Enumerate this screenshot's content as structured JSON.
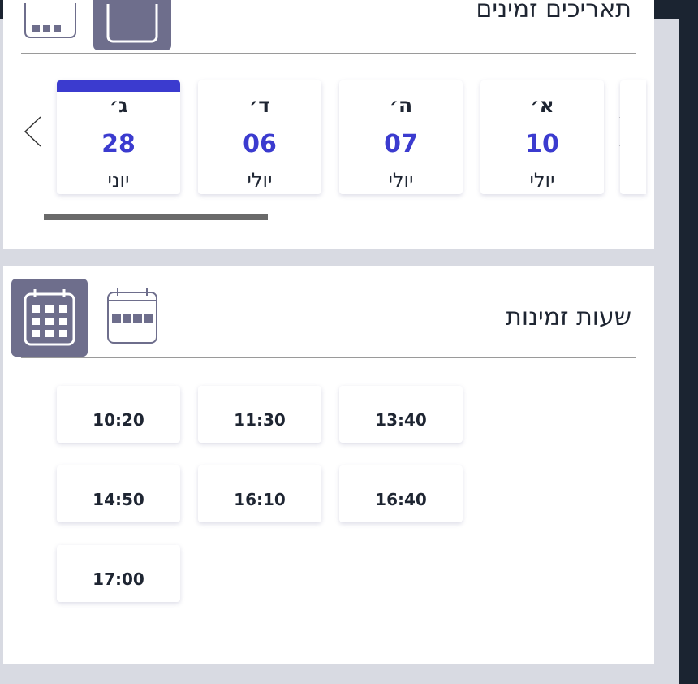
{
  "dates_panel": {
    "title": "תאריכים זמינים",
    "dates": [
      {
        "day": "ג׳",
        "num": "28",
        "month": "יוני",
        "selected": true
      },
      {
        "day": "ד׳",
        "num": "06",
        "month": "יולי",
        "selected": false
      },
      {
        "day": "ה׳",
        "num": "07",
        "month": "יולי",
        "selected": false
      },
      {
        "day": "א׳",
        "num": "10",
        "month": "יולי",
        "selected": false
      }
    ]
  },
  "times_panel": {
    "title": "שעות זמינות",
    "times": [
      "10:20",
      "11:30",
      "13:40",
      "14:50",
      "16:10",
      "16:40",
      "17:00"
    ]
  },
  "colors": {
    "accent": "#3b3bcf",
    "view_active": "#6e6e8c",
    "background": "#d8dae2",
    "frame": "#1b2431"
  },
  "icons": {
    "grid_view": "calendar-grid-icon",
    "strip_view": "calendar-strip-icon",
    "prev": "chevron-left-icon",
    "next": "chevron-right-icon"
  }
}
